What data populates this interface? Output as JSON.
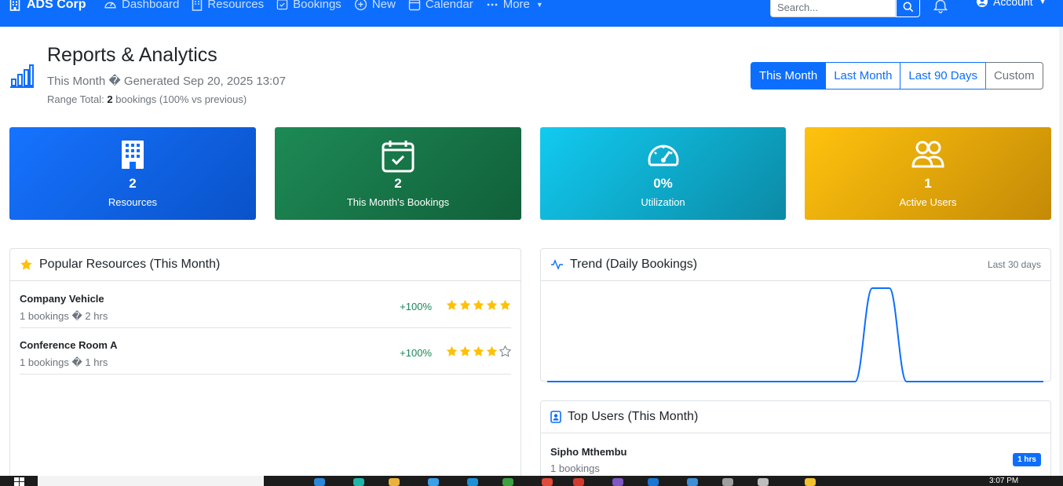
{
  "navbar": {
    "brand": "ADS Corp",
    "links": [
      {
        "label": "Dashboard",
        "icon": "speedometer-icon"
      },
      {
        "label": "Resources",
        "icon": "building-icon"
      },
      {
        "label": "Bookings",
        "icon": "calendar-check-icon"
      },
      {
        "label": "New",
        "icon": "plus-circle-icon"
      },
      {
        "label": "Calendar",
        "icon": "calendar-icon"
      },
      {
        "label": "More",
        "icon": "dots-icon"
      }
    ],
    "search_placeholder": "Search...",
    "account_label": "Account"
  },
  "header": {
    "title": "Reports & Analytics",
    "subtitle": "This Month � Generated Sep 20, 2025 13:07",
    "range_prefix": "Range Total:",
    "range_count": "2",
    "range_suffix": "bookings (100% vs previous)"
  },
  "range_buttons": {
    "this_month": "This Month",
    "last_month": "Last Month",
    "last_90_days": "Last 90 Days",
    "custom": "Custom",
    "active": "This Month"
  },
  "stats": [
    {
      "value": "2",
      "label": "Resources",
      "icon": "building-icon",
      "color": "#0d6efd"
    },
    {
      "value": "2",
      "label": "This Month's Bookings",
      "icon": "calendar-check-icon",
      "color": "#198754"
    },
    {
      "value": "0%",
      "label": "Utilization",
      "icon": "speedometer-icon",
      "color": "#0dcaf0"
    },
    {
      "value": "1",
      "label": "Active Users",
      "icon": "people-icon",
      "color": "#ffc107"
    }
  ],
  "popular": {
    "title": "Popular Resources (This Month)",
    "items": [
      {
        "name": "Company Vehicle",
        "meta": "1 bookings � 2 hrs",
        "change": "+100%",
        "rating": 5
      },
      {
        "name": "Conference Room A",
        "meta": "1 bookings � 1 hrs",
        "change": "+100%",
        "rating": 4
      }
    ]
  },
  "trend": {
    "title": "Trend (Daily Bookings)",
    "range_label": "Last 30 days"
  },
  "chart_data": {
    "type": "line",
    "x": [
      1,
      2,
      3,
      4,
      5,
      6,
      7,
      8,
      9,
      10,
      11,
      12,
      13,
      14,
      15,
      16,
      17,
      18,
      19,
      20,
      21,
      22,
      23,
      24,
      25,
      26,
      27,
      28,
      29,
      30
    ],
    "series": [
      {
        "values": [
          0,
          0,
          0,
          0,
          0,
          0,
          0,
          0,
          0,
          0,
          0,
          0,
          0,
          0,
          0,
          0,
          0,
          0,
          0,
          0,
          0,
          0,
          0,
          0,
          0,
          0,
          0,
          0,
          0,
          0
        ]
      }
    ],
    "peak": {
      "start_index": 19,
      "end_index": 20,
      "value": 1
    },
    "color": "#0d6efd",
    "grid": false
  },
  "top_users": {
    "title": "Top Users (This Month)",
    "items": [
      {
        "name": "Sipho Mthembu",
        "meta": "1 bookings",
        "badge": "1 hrs"
      }
    ]
  },
  "taskbar": {
    "clock": "3:07 PM"
  },
  "colors": {
    "primary": "#0d6efd",
    "success": "#198754",
    "info": "#0dcaf0",
    "warning": "#ffc107",
    "muted": "#6c757d"
  }
}
